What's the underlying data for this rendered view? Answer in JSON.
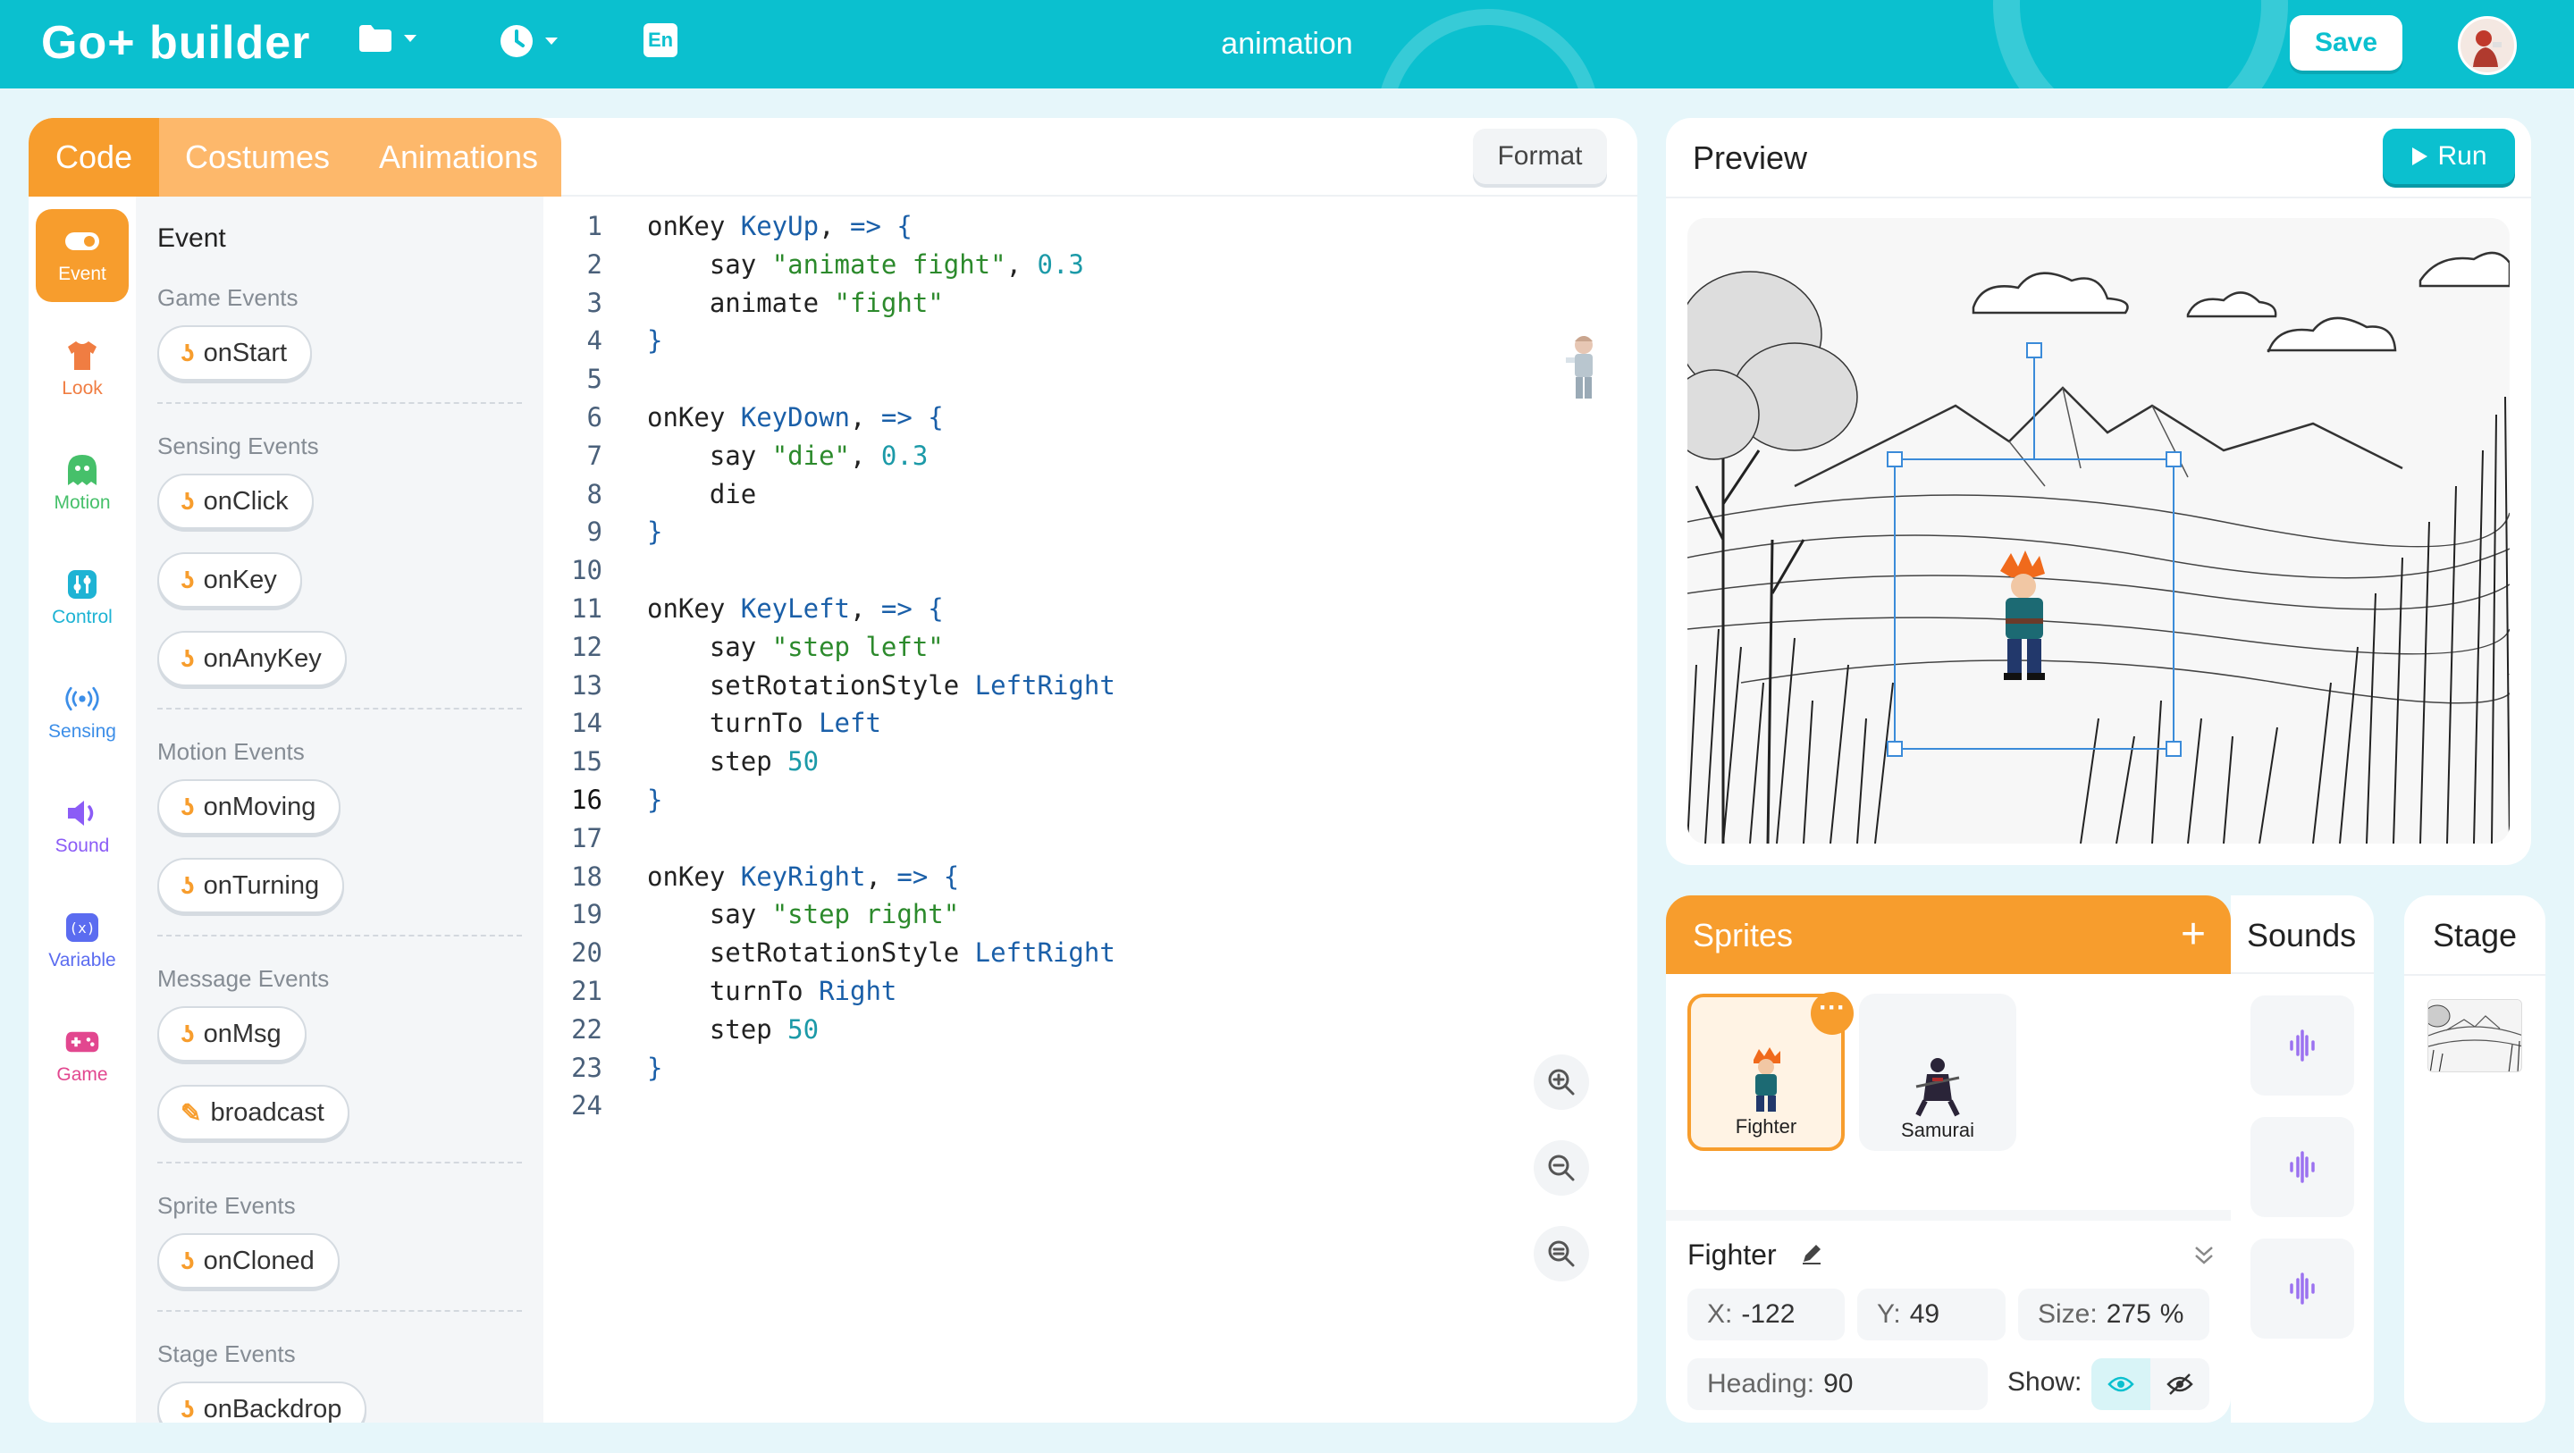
{
  "header": {
    "logo": "Go+ builder",
    "project_title": "animation",
    "save_label": "Save",
    "lang_label": "En",
    "accent": "#0bc0cf"
  },
  "code_panel": {
    "tabs": [
      {
        "label": "Code",
        "active": true
      },
      {
        "label": "Costumes",
        "active": false
      },
      {
        "label": "Animations",
        "active": false
      }
    ],
    "format_label": "Format",
    "categories": [
      {
        "label": "Event",
        "icon": "toggle-icon",
        "color": "#f79d2d",
        "active": true
      },
      {
        "label": "Look",
        "icon": "shirt-icon",
        "color": "#f07d42"
      },
      {
        "label": "Motion",
        "icon": "ghost-icon",
        "color": "#46c06a"
      },
      {
        "label": "Control",
        "icon": "sliders-icon",
        "color": "#1eb3d4"
      },
      {
        "label": "Sensing",
        "icon": "signal-icon",
        "color": "#3c8ee8"
      },
      {
        "label": "Sound",
        "icon": "speaker-icon",
        "color": "#8b5cf6"
      },
      {
        "label": "Variable",
        "icon": "variable-icon",
        "color": "#5b6cf0"
      },
      {
        "label": "Game",
        "icon": "gamepad-icon",
        "color": "#e2478f"
      }
    ],
    "blocks": {
      "title": "Event",
      "groups": [
        {
          "label": "Game Events",
          "items": [
            "onStart"
          ]
        },
        {
          "label": "Sensing Events",
          "items": [
            "onClick",
            "onKey",
            "onAnyKey"
          ]
        },
        {
          "label": "Motion Events",
          "items": [
            "onMoving",
            "onTurning"
          ]
        },
        {
          "label": "Message Events",
          "items": [
            "onMsg",
            "broadcast"
          ]
        },
        {
          "label": "Sprite Events",
          "items": [
            "onCloned"
          ]
        },
        {
          "label": "Stage Events",
          "items": [
            "onBackdrop"
          ]
        }
      ]
    },
    "editor": {
      "current_line": 16,
      "lines": [
        "onKey KeyUp, => {",
        "    say \"animate fight\", 0.3",
        "    animate \"fight\"",
        "}",
        "",
        "onKey KeyDown, => {",
        "    say \"die\", 0.3",
        "    die",
        "}",
        "",
        "onKey KeyLeft, => {",
        "    say \"step left\"",
        "    setRotationStyle LeftRight",
        "    turnTo Left",
        "    step 50",
        "}",
        "",
        "onKey KeyRight, => {",
        "    say \"step right\"",
        "    setRotationStyle LeftRight",
        "    turnTo Right",
        "    step 50",
        "}",
        ""
      ]
    }
  },
  "preview": {
    "title": "Preview",
    "run_label": "Run"
  },
  "sprites": {
    "title": "Sprites",
    "add_label": "+",
    "items": [
      {
        "name": "Fighter",
        "selected": true
      },
      {
        "name": "Samurai",
        "selected": false
      }
    ],
    "selected": {
      "name": "Fighter",
      "x_label": "X:",
      "x": "-122",
      "y_label": "Y:",
      "y": "49",
      "size_label": "Size:",
      "size": "275",
      "size_unit": "%",
      "heading_label": "Heading:",
      "heading": "90",
      "show_label": "Show:",
      "visible": true
    }
  },
  "sounds": {
    "title": "Sounds",
    "count": 3
  },
  "stage": {
    "title": "Stage"
  }
}
